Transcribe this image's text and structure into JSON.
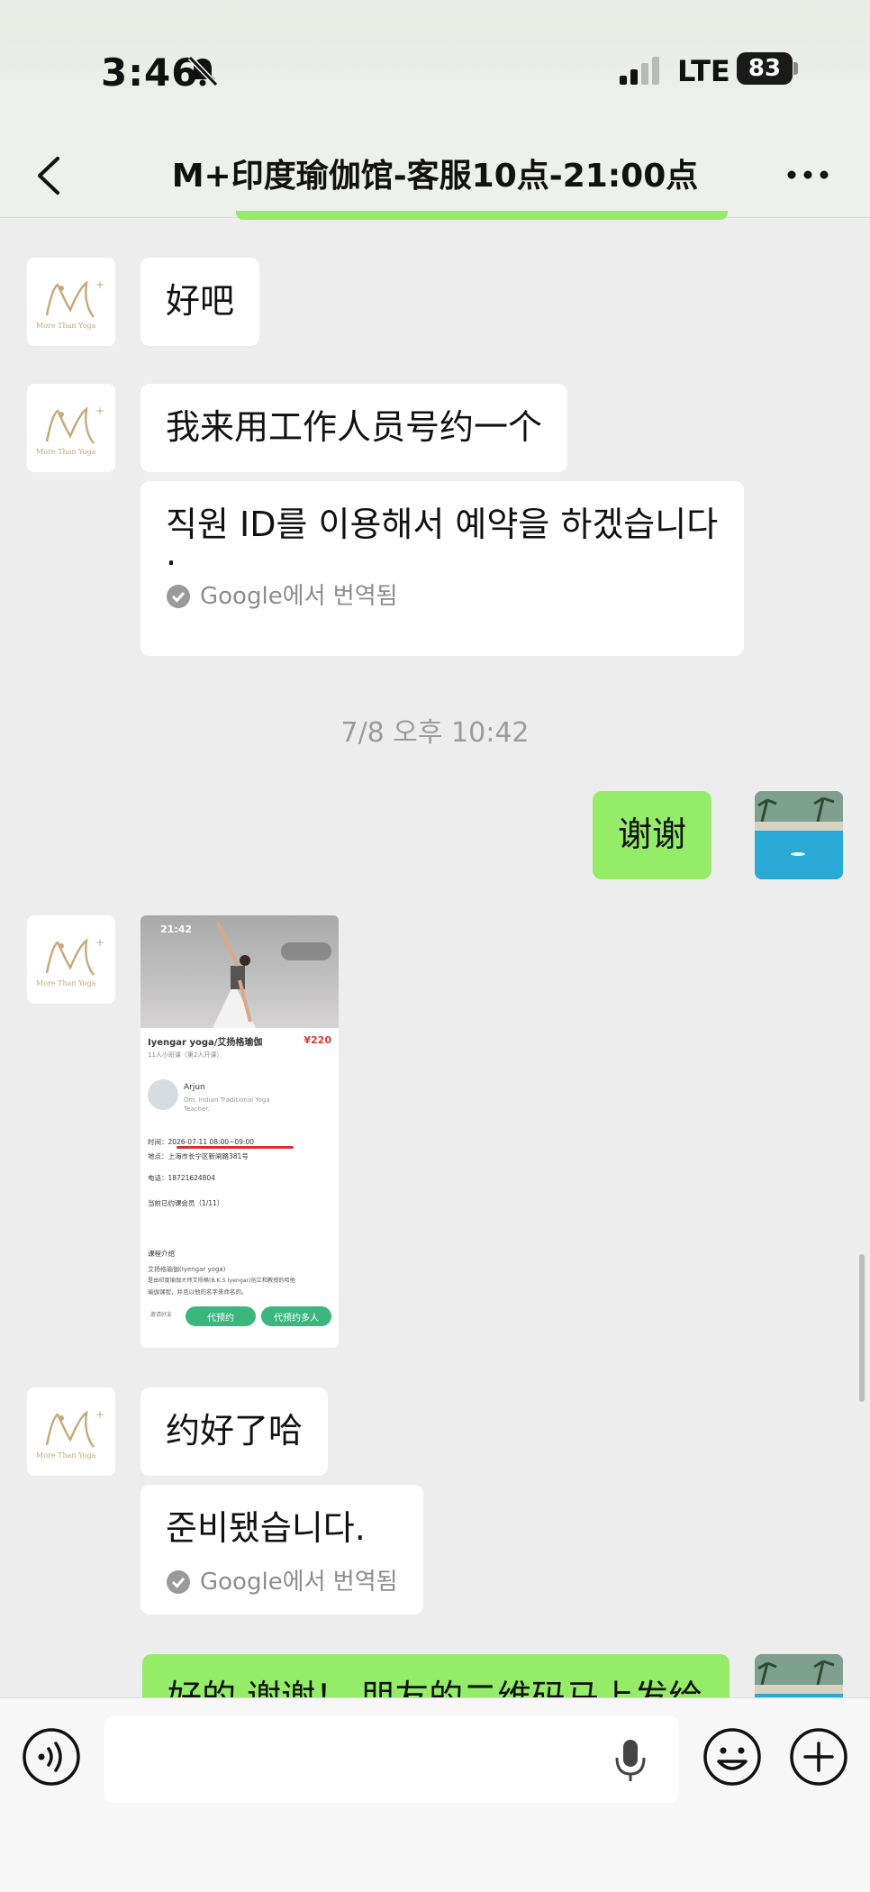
{
  "status_bar": {
    "time": "3:46",
    "network": "LTE",
    "battery": "83"
  },
  "header": {
    "title": "M+印度瑜伽馆-客服10点-21:00点"
  },
  "logo": {
    "mark": "M+",
    "text": "More Than Yoga"
  },
  "messages": [
    {
      "text": "好吧"
    },
    {
      "text": "我来用工作人员号约一个",
      "translation": "직원 ID를 이용해서 예약을 하겠습니다",
      "translation_tail": ".",
      "translation_note": "Google에서 번역됨"
    },
    {
      "text": "谢谢"
    },
    {
      "text": "约好了哈",
      "translation": "준비됐습니다.",
      "translation_note": "Google에서 번역됨"
    },
    {
      "text": "好的 谢谢！ 朋友的二维码马上发给"
    }
  ],
  "timestamp": "7/8 오후 10:42",
  "shared_screenshot": {
    "time": "21:42",
    "title": "Iyengar yoga/艾扬格瑜伽",
    "price": "¥220",
    "subtitle": "11人小班课（第2人开课）",
    "teacher_name": "Arjun",
    "teacher_desc": "Om. Indian Traditional Yoga Teacher.",
    "time_row": "时间：2026-07-11 08:00~09:00",
    "location_row": "地点：上海市长宁区新闸路381号",
    "phone_row": "电话：18721624804",
    "members_row": "当前已约课会员（1/11）",
    "intro_title": "课程介绍",
    "intro_line1": "艾扬格瑜伽(Iyengar yoga)",
    "intro_line2": "是由印度瑜伽大师艾扬格(B.K.S Iyengar)创立和教授的哈他",
    "intro_line3": "瑜伽课程，并且以他的名字来命名的。",
    "btn_book": "代预约",
    "btn_book_multi": "代预约多人",
    "share_label": "邀请好友"
  },
  "input": {
    "placeholder": ""
  },
  "colors": {
    "green_bubble": "#95ec69",
    "background": "#ededed",
    "translate_gray": "#8d8d8d",
    "logo_gold": "#c8a97a"
  }
}
